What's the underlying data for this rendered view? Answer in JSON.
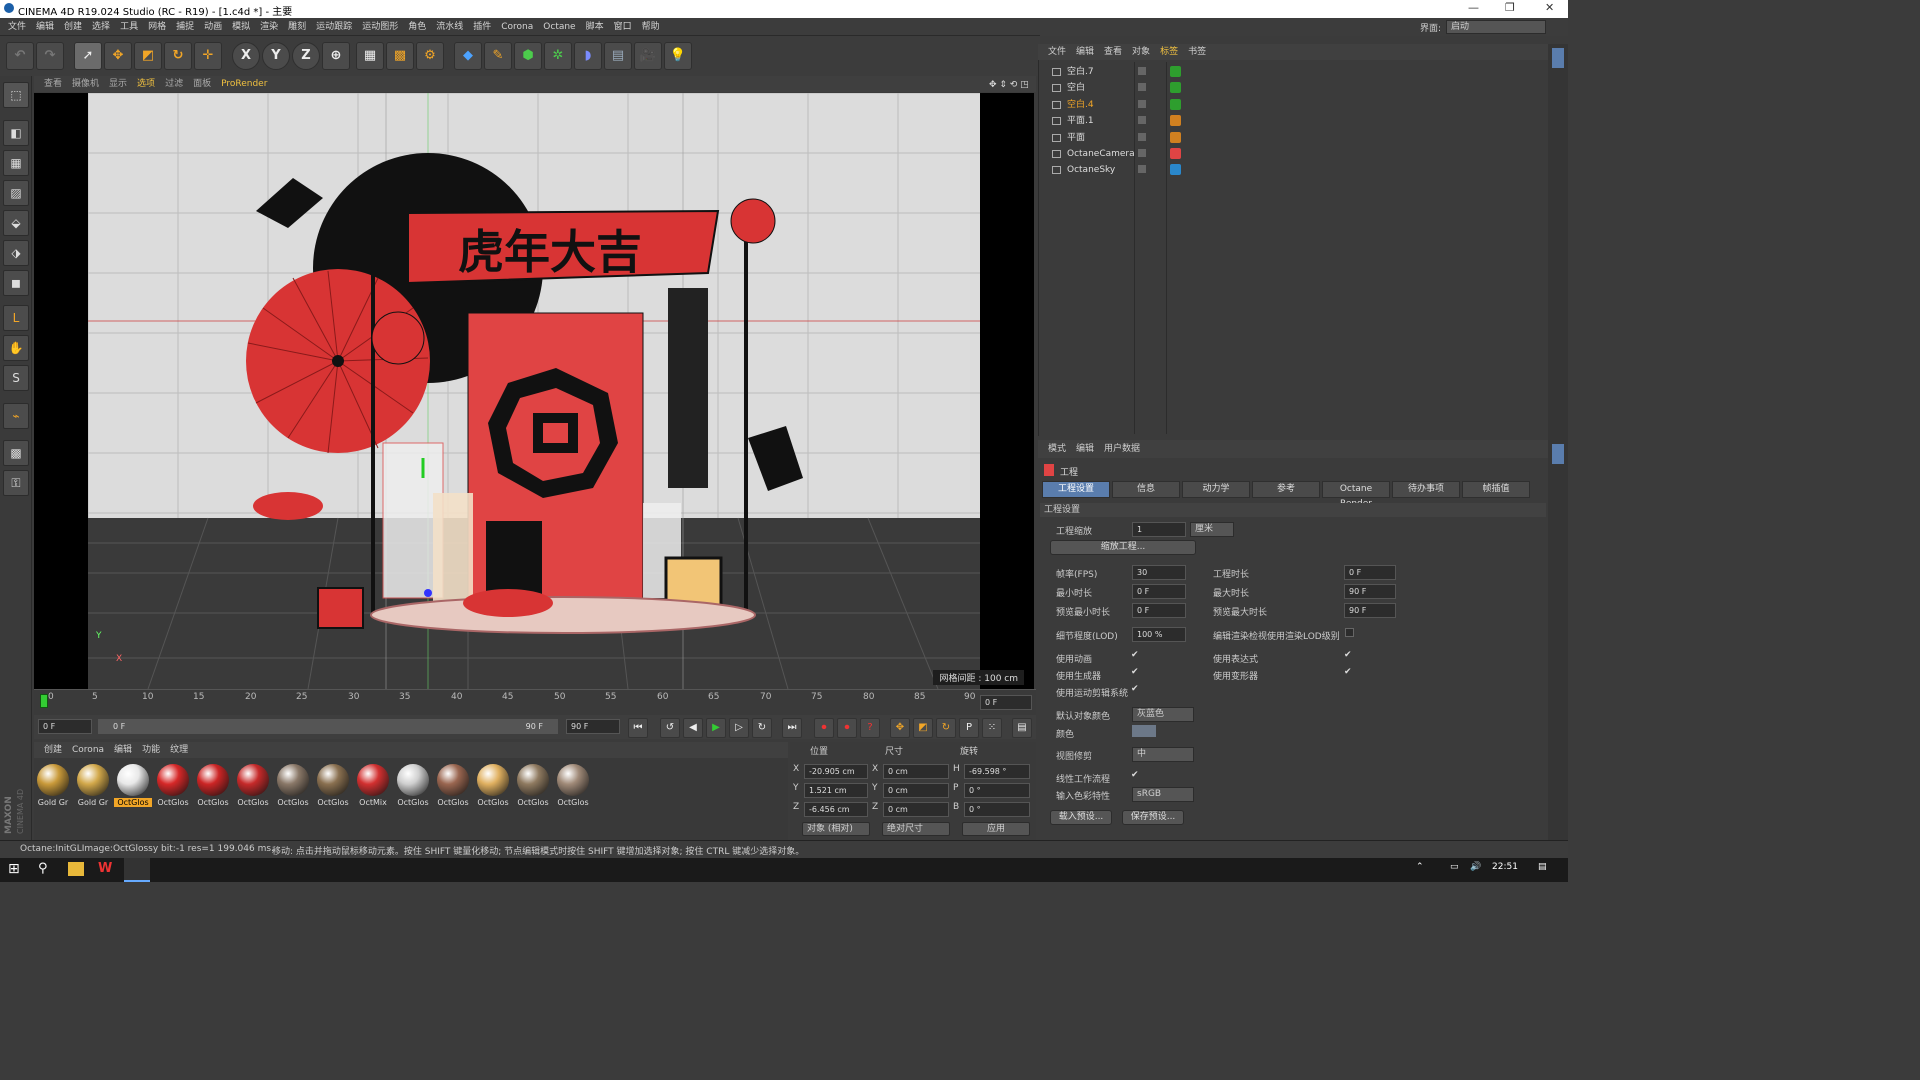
{
  "window": {
    "title": "CINEMA 4D R19.024 Studio (RC - R19) - [1.c4d *] - 主要"
  },
  "menu": [
    "文件",
    "编辑",
    "创建",
    "选择",
    "工具",
    "网格",
    "捕捉",
    "动画",
    "模拟",
    "渲染",
    "雕刻",
    "运动跟踪",
    "运动图形",
    "角色",
    "流水线",
    "插件",
    "Corona",
    "Octane",
    "脚本",
    "窗口",
    "帮助"
  ],
  "layout": {
    "label": "界面:",
    "value": "启动"
  },
  "toolbar": {
    "axes": [
      "X",
      "Y",
      "Z"
    ]
  },
  "viewport": {
    "menu": [
      "查看",
      "摄像机",
      "显示",
      "选项",
      "过滤",
      "面板",
      "ProRender"
    ],
    "active": "选项",
    "grid_label": "网格间距 : 100 cm",
    "banner_text": "虎年大吉",
    "axis_y": "Y",
    "axis_x": "X"
  },
  "timeline": {
    "ticks": [
      "0",
      "5",
      "10",
      "15",
      "20",
      "25",
      "30",
      "35",
      "40",
      "45",
      "50",
      "55",
      "60",
      "65",
      "70",
      "75",
      "80",
      "85",
      "90"
    ],
    "end_field": "0 F"
  },
  "transport": {
    "start": "0 F",
    "range_start": "0 F",
    "range_end": "90 F",
    "end": "90 F"
  },
  "materials": {
    "menu": [
      "创建",
      "Corona",
      "编辑",
      "功能",
      "纹理"
    ],
    "items": [
      {
        "label": "Gold Gr",
        "color": "#c99a3a"
      },
      {
        "label": "Gold Gr",
        "color": "#d2a84a"
      },
      {
        "label": "OctGlos",
        "color": "#e8e8e8"
      },
      {
        "label": "OctGlos",
        "color": "#d62828"
      },
      {
        "label": "OctGlos",
        "color": "#cc2525"
      },
      {
        "label": "OctGlos",
        "color": "#c62a2a"
      },
      {
        "label": "OctGlos",
        "color": "#8a7868"
      },
      {
        "label": "OctGlos",
        "color": "#8a7050"
      },
      {
        "label": "OctMix",
        "color": "#d23030"
      },
      {
        "label": "OctGlos",
        "color": "#cfcfcf"
      },
      {
        "label": "OctGlos",
        "color": "#9a6650"
      },
      {
        "label": "OctGlos",
        "color": "#e0b060"
      },
      {
        "label": "OctGlos",
        "color": "#8f7a60"
      },
      {
        "label": "OctGlos",
        "color": "#a08a78"
      }
    ]
  },
  "coords": {
    "headers": [
      "位置",
      "尺寸",
      "旋转"
    ],
    "rows": [
      {
        "axis": "X",
        "pos": "-20.905 cm",
        "size_axis": "X",
        "size": "0 cm",
        "rot_axis": "H",
        "rot": "-69.598 °"
      },
      {
        "axis": "Y",
        "pos": "1.521 cm",
        "size_axis": "Y",
        "size": "0 cm",
        "rot_axis": "P",
        "rot": "0 °"
      },
      {
        "axis": "Z",
        "pos": "-6.456 cm",
        "size_axis": "Z",
        "size": "0 cm",
        "rot_axis": "B",
        "rot": "0 °"
      }
    ],
    "mode1": "对象 (相对)",
    "mode2": "绝对尺寸",
    "apply": "应用"
  },
  "objects": {
    "menu": [
      "文件",
      "编辑",
      "查看",
      "对象",
      "标签",
      "书签"
    ],
    "rows": [
      {
        "name": "空白.7",
        "sel": false
      },
      {
        "name": "空白",
        "sel": false
      },
      {
        "name": "空白.4",
        "sel": true
      },
      {
        "name": "平面.1",
        "sel": false
      },
      {
        "name": "平面",
        "sel": false
      },
      {
        "name": "OctaneCamera",
        "sel": false
      },
      {
        "name": "OctaneSky",
        "sel": false
      }
    ]
  },
  "attributes": {
    "menu": [
      "模式",
      "编辑",
      "用户数据"
    ],
    "heading": "工程",
    "tabs": [
      "工程设置",
      "信息",
      "动力学",
      "参考",
      "Octane Render",
      "待办事项",
      "帧插值"
    ],
    "section": "工程设置",
    "scale_label": "工程缩放",
    "scale_value": "1",
    "scale_unit": "厘米",
    "scale_btn": "缩放工程...",
    "fps_label": "帧率(FPS)",
    "fps": "30",
    "projlen_label": "工程时长",
    "projlen": "0 F",
    "min_label": "最小时长",
    "min": "0 F",
    "max_label": "最大时长",
    "max": "90 F",
    "pmin_label": "预览最小时长",
    "pmin": "0 F",
    "pmax_label": "预览最大时长",
    "pmax": "90 F",
    "lod_label": "细节程度(LOD)",
    "lod": "100 %",
    "lod_check_label": "编辑渲染检视使用渲染LOD级别",
    "anim_label": "使用动画",
    "expr_label": "使用表达式",
    "gen_label": "使用生成器",
    "deform_label": "使用变形器",
    "motion_label": "使用运动剪辑系统",
    "color_label": "默认对象颜色",
    "color_value": "灰蓝色",
    "color2_label": "颜色",
    "clip_label": "视图修剪",
    "clip_value": "中",
    "linear_label": "线性工作流程",
    "input_label": "输入色彩特性",
    "input_value": "sRGB",
    "load_btn": "载入预设...",
    "save_btn": "保存预设..."
  },
  "status": {
    "left": "Octane:InitGLImage:OctGlossy bit:-1 res=1 199.046 ms.",
    "right": "移动: 点击并拖动鼠标移动元素。按住 SHIFT 键量化移动; 节点编辑模式时按住 SHIFT 键增加选择对象; 按住 CTRL 键减少选择对象。"
  },
  "taskbar": {
    "time": "22:51"
  },
  "side": {
    "maxon": "MAXON",
    "c4d": "CINEMA 4D"
  }
}
